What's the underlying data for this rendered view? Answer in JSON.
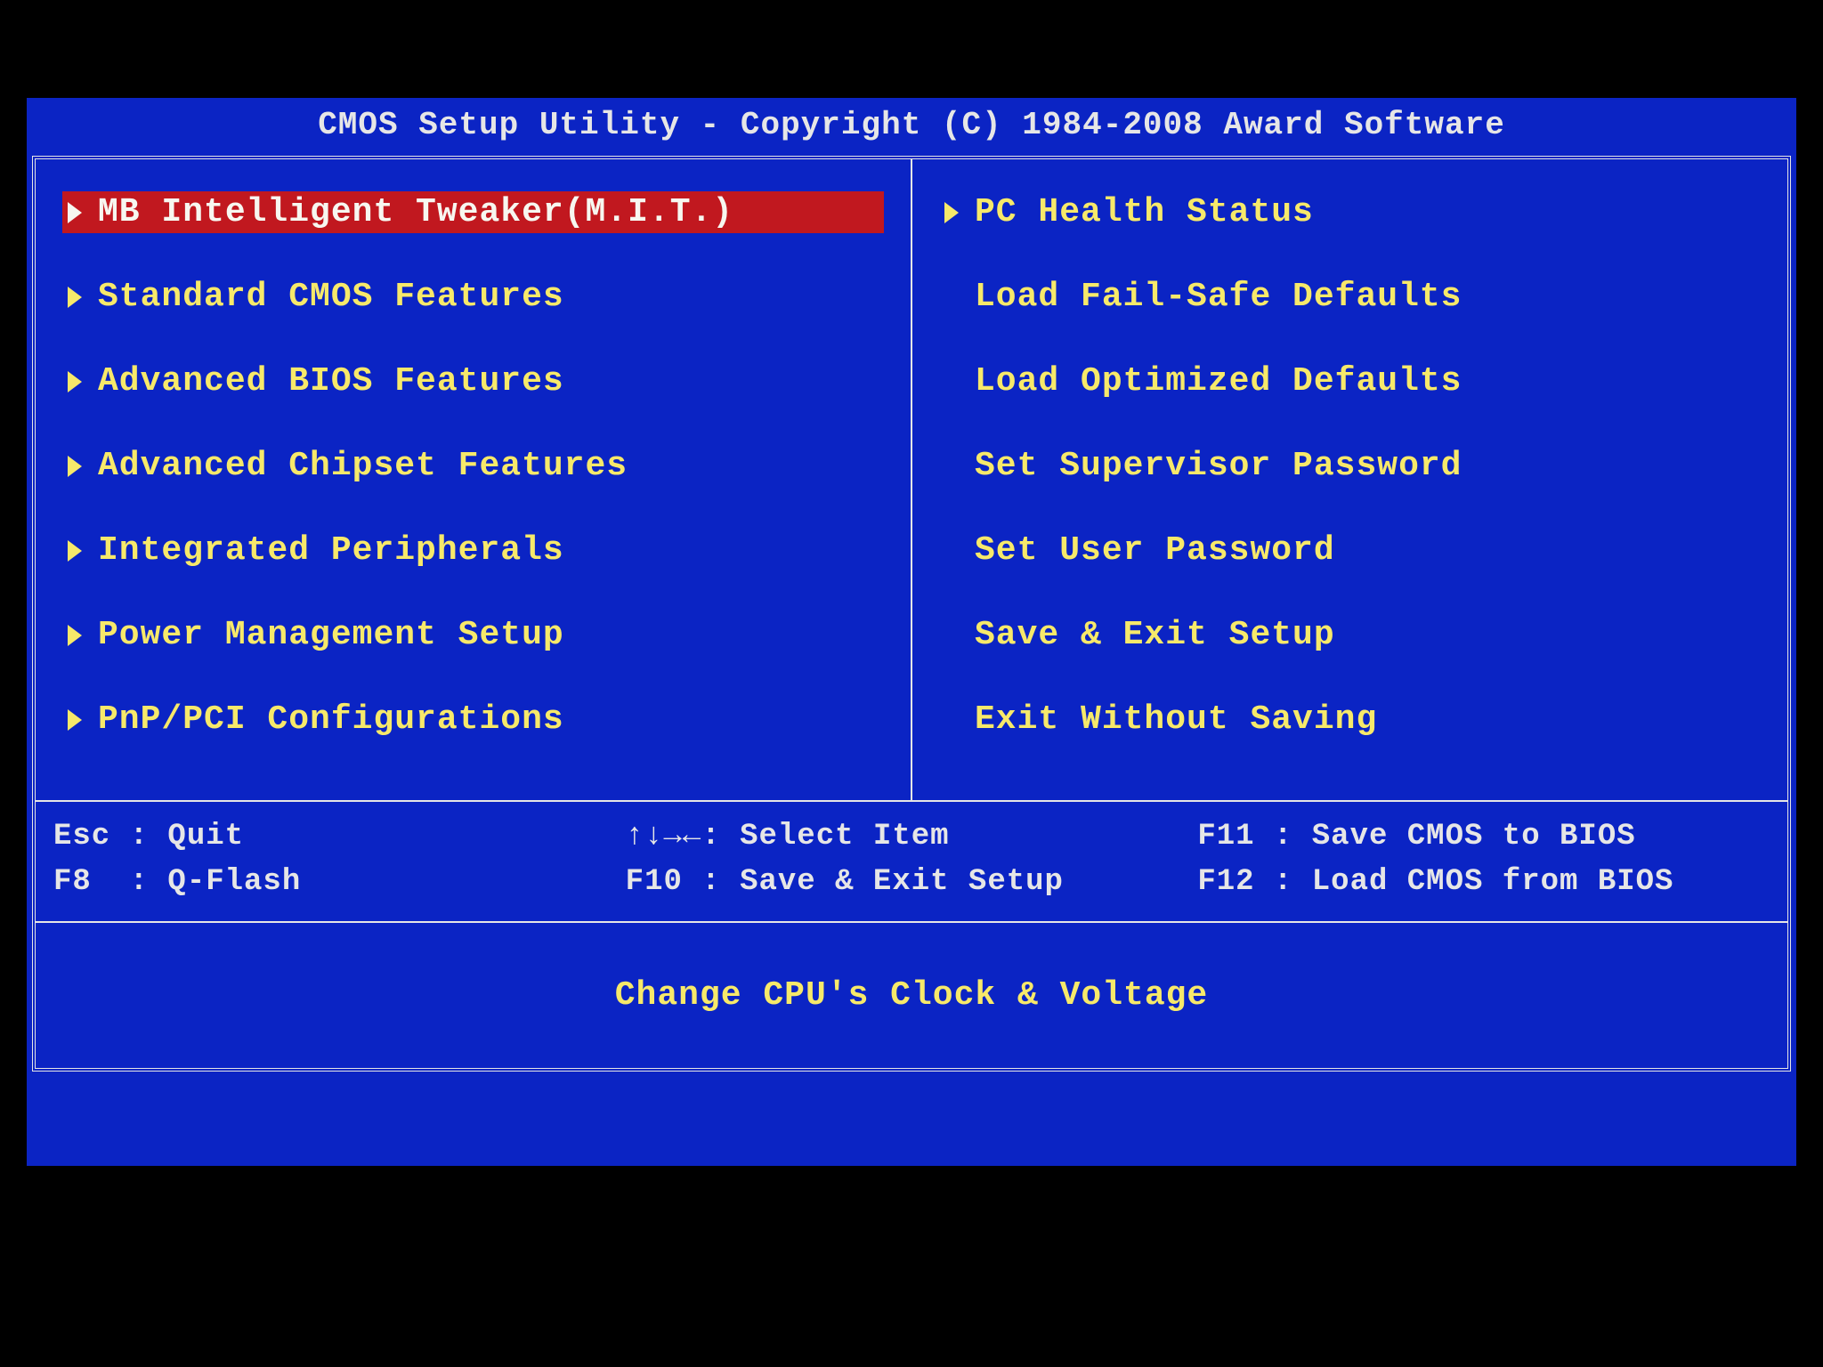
{
  "title": "CMOS Setup Utility - Copyright (C) 1984-2008 Award Software",
  "menu": {
    "left": [
      {
        "label": "MB Intelligent Tweaker(M.I.T.)",
        "arrow": true,
        "selected": true
      },
      {
        "label": "Standard CMOS Features",
        "arrow": true,
        "selected": false
      },
      {
        "label": "Advanced BIOS Features",
        "arrow": true,
        "selected": false
      },
      {
        "label": "Advanced Chipset Features",
        "arrow": true,
        "selected": false
      },
      {
        "label": "Integrated Peripherals",
        "arrow": true,
        "selected": false
      },
      {
        "label": "Power Management Setup",
        "arrow": true,
        "selected": false
      },
      {
        "label": "PnP/PCI Configurations",
        "arrow": true,
        "selected": false
      }
    ],
    "right": [
      {
        "label": "PC Health Status",
        "arrow": true,
        "selected": false
      },
      {
        "label": "Load Fail-Safe Defaults",
        "arrow": false,
        "selected": false
      },
      {
        "label": "Load Optimized Defaults",
        "arrow": false,
        "selected": false
      },
      {
        "label": "Set Supervisor Password",
        "arrow": false,
        "selected": false
      },
      {
        "label": "Set User Password",
        "arrow": false,
        "selected": false
      },
      {
        "label": "Save & Exit Setup",
        "arrow": false,
        "selected": false
      },
      {
        "label": "Exit Without Saving",
        "arrow": false,
        "selected": false
      }
    ]
  },
  "help": {
    "col1": "Esc : Quit\nF8  : Q-Flash",
    "col2": "↑↓→←: Select Item\nF10 : Save & Exit Setup",
    "col3": "F11 : Save CMOS to BIOS\nF12 : Load CMOS from BIOS"
  },
  "hint": "Change CPU's Clock & Voltage"
}
